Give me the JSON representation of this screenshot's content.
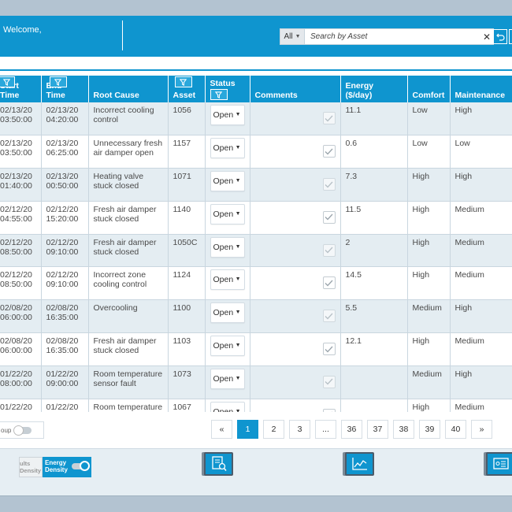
{
  "header": {
    "welcome": "Welcome,",
    "search": {
      "filter_value": "All",
      "placeholder": "Search by Asset"
    }
  },
  "colors": {
    "accent": "#0f95cf",
    "row_alt": "#e4edf2",
    "frame_bg": "#b3c3d1"
  },
  "table": {
    "columns": {
      "start_time": "Start Time",
      "end_time": "End Time",
      "root_cause": "Root Cause",
      "asset": "Asset",
      "status": "Status",
      "comments": "Comments",
      "energy": "Energy ($/day)",
      "comfort": "Comfort",
      "maintenance": "Maintenance"
    },
    "rows": [
      {
        "start_date": "02/13/20",
        "start_time": "03:50:00",
        "end_date": "02/13/20",
        "end_time": "04:20:00",
        "root_cause": "Incorrect cooling control",
        "asset": "1056",
        "status": "Open",
        "checked": true,
        "energy": "11.1",
        "comfort": "Low",
        "maintenance": "High"
      },
      {
        "start_date": "02/13/20",
        "start_time": "03:50:00",
        "end_date": "02/13/20",
        "end_time": "06:25:00",
        "root_cause": "Unnecessary fresh air damper open",
        "asset": "1157",
        "status": "Open",
        "checked": true,
        "energy": "0.6",
        "comfort": "Low",
        "maintenance": "Low"
      },
      {
        "start_date": "02/13/20",
        "start_time": "01:40:00",
        "end_date": "02/13/20",
        "end_time": "00:50:00",
        "root_cause": "Heating valve stuck closed",
        "asset": "1071",
        "status": "Open",
        "checked": true,
        "energy": "7.3",
        "comfort": "High",
        "maintenance": "High"
      },
      {
        "start_date": "02/12/20",
        "start_time": "04:55:00",
        "end_date": "02/12/20",
        "end_time": "15:20:00",
        "root_cause": "Fresh air damper stuck closed",
        "asset": "1140",
        "status": "Open",
        "checked": true,
        "energy": "11.5",
        "comfort": "High",
        "maintenance": "Medium"
      },
      {
        "start_date": "02/12/20",
        "start_time": "08:50:00",
        "end_date": "02/12/20",
        "end_time": "09:10:00",
        "root_cause": "Fresh air damper stuck closed",
        "asset": "1050C",
        "status": "Open",
        "checked": true,
        "energy": "2",
        "comfort": "High",
        "maintenance": "Medium"
      },
      {
        "start_date": "02/12/20",
        "start_time": "08:50:00",
        "end_date": "02/12/20",
        "end_time": "09:10:00",
        "root_cause": "Incorrect zone cooling control",
        "asset": "1124",
        "status": "Open",
        "checked": true,
        "energy": "14.5",
        "comfort": "High",
        "maintenance": "Medium"
      },
      {
        "start_date": "02/08/20",
        "start_time": "06:00:00",
        "end_date": "02/08/20",
        "end_time": "16:35:00",
        "root_cause": "Overcooling",
        "asset": "1100",
        "status": "Open",
        "checked": true,
        "energy": "5.5",
        "comfort": "Medium",
        "maintenance": "High"
      },
      {
        "start_date": "02/08/20",
        "start_time": "06:00:00",
        "end_date": "02/08/20",
        "end_time": "16:35:00",
        "root_cause": "Fresh air damper stuck closed",
        "asset": "1103",
        "status": "Open",
        "checked": true,
        "energy": "12.1",
        "comfort": "High",
        "maintenance": "Medium"
      },
      {
        "start_date": "01/22/20",
        "start_time": "08:00:00",
        "end_date": "01/22/20",
        "end_time": "09:00:00",
        "root_cause": "Room temperature sensor fault",
        "asset": "1073",
        "status": "Open",
        "checked": true,
        "energy": "",
        "comfort": "Medium",
        "maintenance": "High"
      },
      {
        "start_date": "01/22/20",
        "start_time": "",
        "end_date": "01/22/20",
        "end_time": "",
        "root_cause": "Room temperature",
        "asset": "1067",
        "status": "Open",
        "checked": true,
        "energy": "",
        "comfort": "High",
        "maintenance": "Medium"
      }
    ]
  },
  "group_toggle": {
    "label": "oup"
  },
  "pagination": {
    "prev": "«",
    "pages": [
      "1",
      "2",
      "3",
      "...",
      "36",
      "37",
      "38",
      "39",
      "40"
    ],
    "active": "1",
    "next": "»"
  },
  "density_toggle": {
    "off_label": "ults Density",
    "on_label": "Energy Density"
  },
  "nav_icons": [
    "report-search-icon",
    "trend-chart-icon",
    "equipment-panel-icon"
  ]
}
